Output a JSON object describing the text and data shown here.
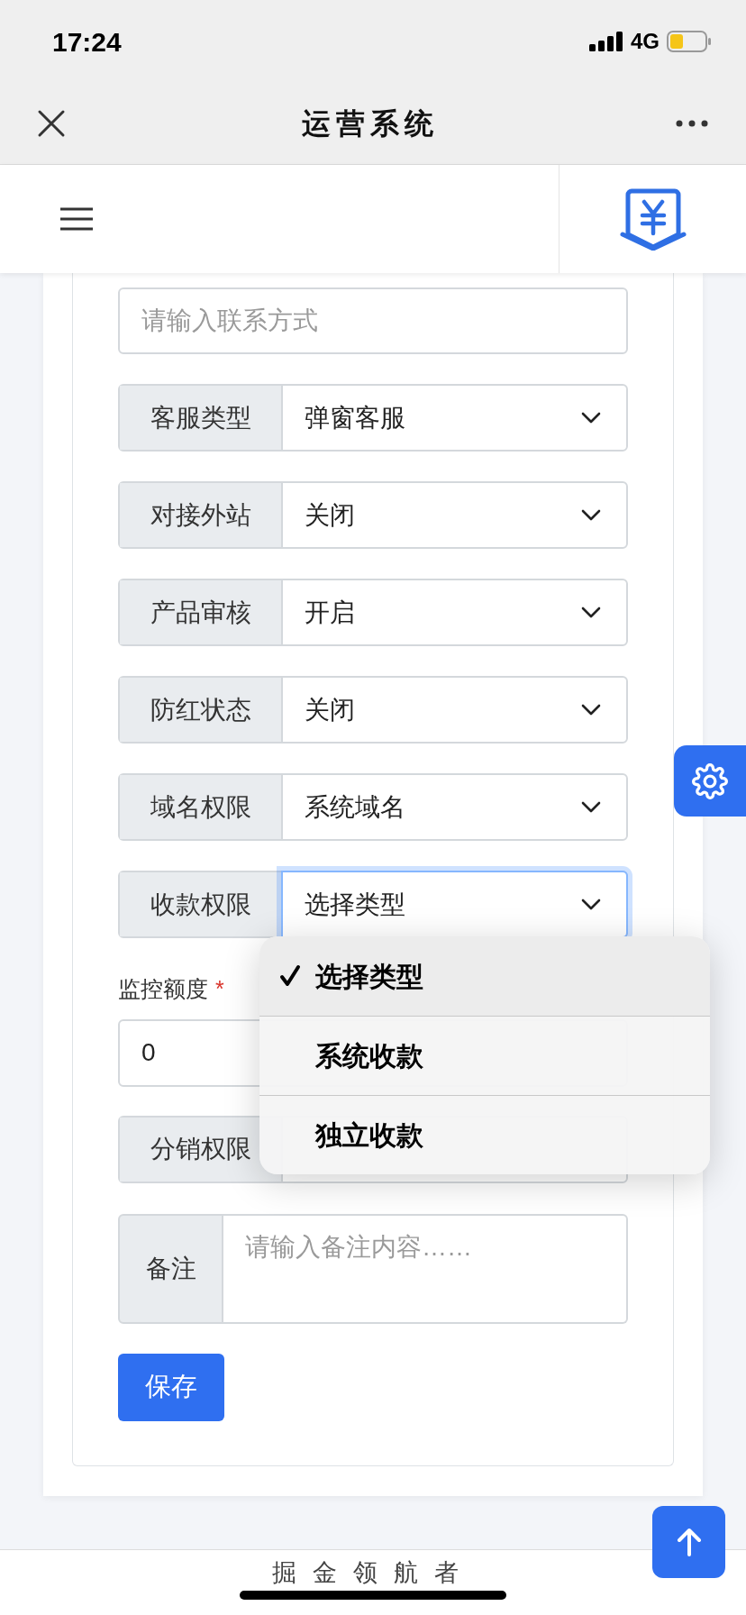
{
  "status_bar": {
    "time": "17:24",
    "network": "4G"
  },
  "nav_bar": {
    "title": "运营系统"
  },
  "form": {
    "contact_field": {
      "placeholder": "请输入联系方式"
    },
    "selects": [
      {
        "label": "客服类型",
        "value": "弹窗客服",
        "focused": false
      },
      {
        "label": "对接外站",
        "value": "关闭",
        "focused": false
      },
      {
        "label": "产品审核",
        "value": "开启",
        "focused": false
      },
      {
        "label": "防红状态",
        "value": "关闭",
        "focused": false
      },
      {
        "label": "域名权限",
        "value": "系统域名",
        "focused": false
      },
      {
        "label": "收款权限",
        "value": "选择类型",
        "focused": true
      }
    ],
    "monitor_amount": {
      "label": "监控额度",
      "required": "*",
      "value": "0"
    },
    "distribution": {
      "label": "分销权限"
    },
    "remark": {
      "label": "备注",
      "placeholder": "请输入备注内容……"
    },
    "save_button": "保存"
  },
  "dropdown": [
    {
      "label": "选择类型",
      "selected": true
    },
    {
      "label": "系统收款",
      "selected": false
    },
    {
      "label": "独立收款",
      "selected": false
    }
  ],
  "footer": "掘金领航者"
}
